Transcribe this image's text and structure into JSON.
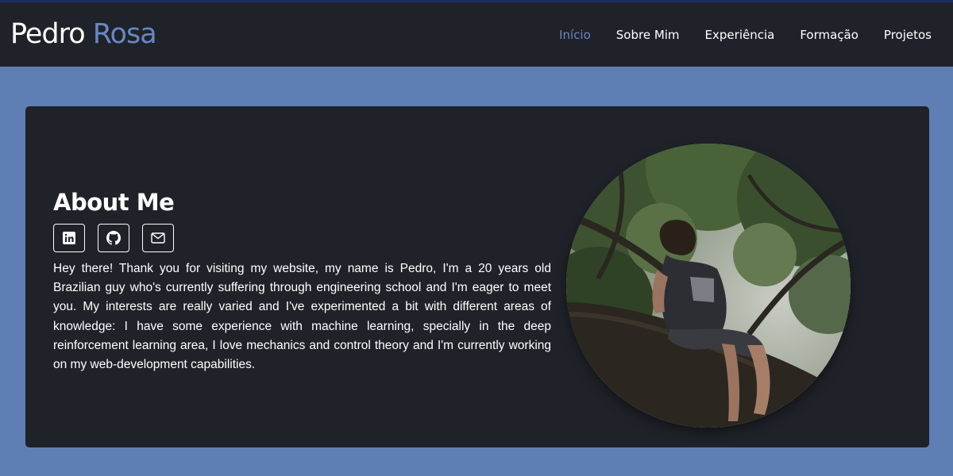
{
  "brand": {
    "first": "Pedro",
    "last": "Rosa"
  },
  "nav": {
    "items": [
      "Início",
      "Sobre Mim",
      "Experiência",
      "Formação",
      "Projetos"
    ]
  },
  "about": {
    "title": "About Me",
    "socials": [
      {
        "icon": "linkedin-icon"
      },
      {
        "icon": "github-icon"
      },
      {
        "icon": "mail-icon"
      }
    ],
    "bio": "Hey there! Thank you for visiting my website, my name is Pedro, I'm a 20 years old Brazilian guy who's currently suffering through engineering school and I'm eager to meet you. My interests are really varied and I've experimented a bit with different areas of knowledge: I have some experience with machine learning, specially in the deep reinforcement learning area, I love mechanics and control theory and I'm currently working on my web-development capabilities."
  },
  "colors": {
    "page_background": "#5f7fb4",
    "panel": "#1f2329",
    "accent": "#6a86c0",
    "text": "#ffffff"
  }
}
